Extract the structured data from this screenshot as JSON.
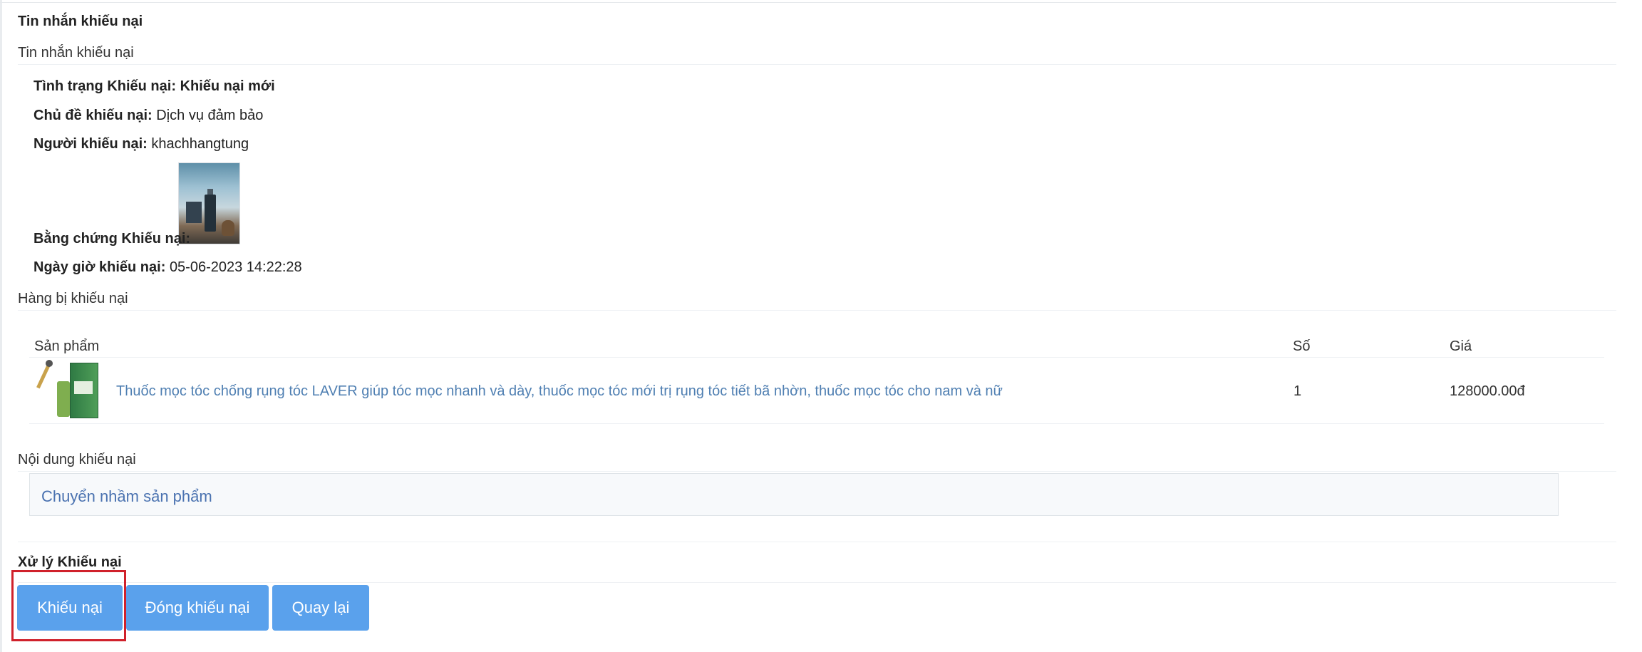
{
  "section": {
    "heading": "Tin nhắn khiếu nại",
    "subheading": "Tin nhắn khiếu nại"
  },
  "info": {
    "status_label": "Tình trạng Khiếu nại:",
    "status_value": "Khiếu nại mới",
    "topic_label": "Chủ đề khiếu nại:",
    "topic_value": "Dịch vụ đảm bảo",
    "person_label": "Người khiếu nại:",
    "person_value": "khachhangtung",
    "evidence_label": "Bằng chứng Khiếu nại:",
    "datetime_label": "Ngày giờ khiếu nại:",
    "datetime_value": "05-06-2023 14:22:28"
  },
  "goods": {
    "heading": "Hàng bị khiếu nại",
    "columns": [
      "Sản phẩm",
      "Số",
      "Giá"
    ],
    "rows": [
      {
        "name": "Thuốc mọc tóc chống rụng tóc LAVER giúp tóc mọc nhanh và dày, thuốc mọc tóc mới trị rụng tóc tiết bã nhờn, thuốc mọc tóc cho nam và nữ",
        "qty": "1",
        "price": "128000.00đ"
      }
    ]
  },
  "content": {
    "heading": "Nội dung khiếu nại",
    "text": "Chuyển nhầm sản phẩm"
  },
  "process": {
    "heading": "Xử lý Khiếu nại",
    "buttons": {
      "complain": "Khiếu nại",
      "close": "Đóng khiếu nại",
      "back": "Quay lại"
    }
  },
  "colors": {
    "button": "#5aa1ec",
    "link": "#4f7fb2",
    "highlight": "#d0212b"
  }
}
